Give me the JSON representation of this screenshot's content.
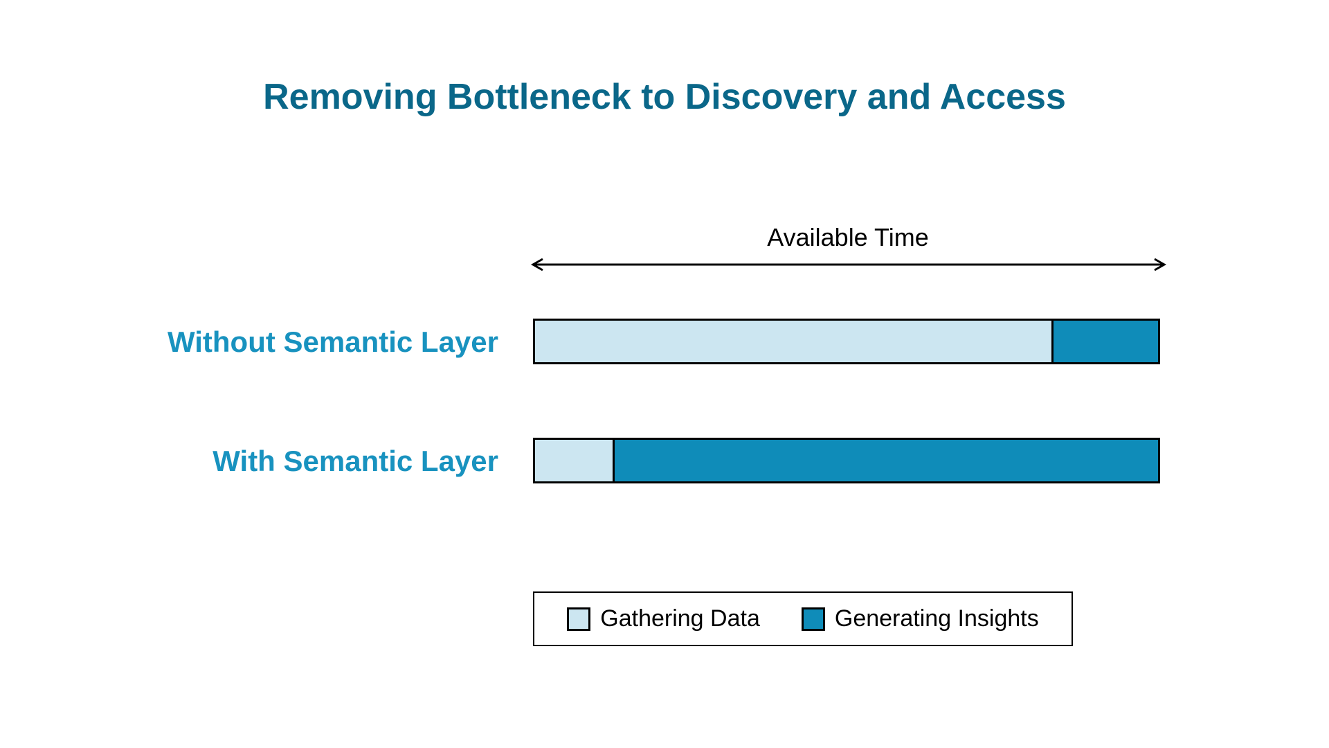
{
  "title": "Removing Bottleneck to Discovery and Access",
  "axis_label": "Available Time",
  "rows": [
    {
      "label": "Without Semantic Layer"
    },
    {
      "label": "With Semantic Layer"
    }
  ],
  "legend": {
    "gathering": "Gathering Data",
    "insights": "Generating Insights"
  },
  "colors": {
    "title": "#0a6789",
    "row_label": "#1892bf",
    "light": "#cce6f1",
    "dark": "#0f8cb9"
  },
  "chart_data": {
    "type": "bar",
    "orientation": "horizontal_stacked",
    "title": "Removing Bottleneck to Discovery and Access",
    "xlabel": "Available Time",
    "ylabel": "",
    "xlim": [
      0,
      100
    ],
    "categories": [
      "Without Semantic Layer",
      "With Semantic Layer"
    ],
    "series": [
      {
        "name": "Gathering Data",
        "values": [
          83,
          13
        ]
      },
      {
        "name": "Generating Insights",
        "values": [
          17,
          87
        ]
      }
    ],
    "legend_position": "bottom"
  }
}
